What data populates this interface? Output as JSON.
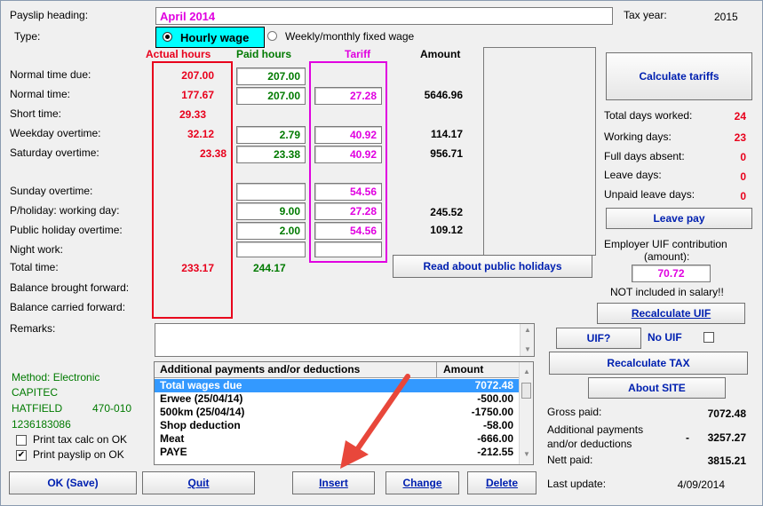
{
  "header": {
    "payslip_heading_label": "Payslip heading:",
    "payslip_heading_value": "April 2014",
    "tax_year_label": "Tax year:",
    "tax_year_value": "2015",
    "type_label": "Type:",
    "type_option_hourly": "Hourly wage",
    "type_option_weekly": "Weekly/monthly fixed wage"
  },
  "columns": {
    "actual_hours": "Actual hours",
    "paid_hours": "Paid hours",
    "tariff": "Tariff",
    "amount": "Amount"
  },
  "rows": [
    {
      "label": "Normal time due:",
      "actual": "207.00",
      "paid": "207.00",
      "tariff": "",
      "amount": ""
    },
    {
      "label": "Normal time:",
      "actual": "177.67",
      "paid": "207.00",
      "tariff": "27.28",
      "amount": "5646.96"
    },
    {
      "label": "Short time:",
      "actual": "29.33",
      "paid": "",
      "tariff": "",
      "amount": ""
    },
    {
      "label": "Weekday overtime:",
      "actual": "32.12",
      "paid": "2.79",
      "tariff": "40.92",
      "amount": "114.17"
    },
    {
      "label": "Saturday overtime:",
      "actual": "23.38",
      "paid": "23.38",
      "tariff": "40.92",
      "amount": "956.71"
    },
    {
      "label": "Sunday overtime:",
      "actual": "",
      "paid": "",
      "tariff": "54.56",
      "amount": ""
    },
    {
      "label": "P/holiday: working day:",
      "actual": "",
      "paid": "9.00",
      "tariff": "27.28",
      "amount": "245.52"
    },
    {
      "label": "Public holiday overtime:",
      "actual": "",
      "paid": "2.00",
      "tariff": "54.56",
      "amount": "109.12"
    },
    {
      "label": "Night work:",
      "actual": "",
      "paid": "",
      "tariff": "",
      "amount": ""
    },
    {
      "label": "Total time:",
      "actual": "233.17",
      "paid": "244.17",
      "tariff": "",
      "amount": ""
    },
    {
      "label": "Balance brought forward:"
    },
    {
      "label": "Balance carried forward:"
    }
  ],
  "remarks_label": "Remarks:",
  "bank": {
    "method": "Method: Electronic",
    "bank_name": "CAPITEC",
    "branch": "HATFIELD",
    "branch_code": "470-010",
    "account": "1236183086",
    "print_tax_calc": "Print tax calc on OK",
    "print_payslip": "Print payslip on OK"
  },
  "right_panel": {
    "calculate_tariffs": "Calculate tariffs",
    "total_days_worked_label": "Total days worked:",
    "total_days_worked": "24",
    "working_days_label": "Working days:",
    "working_days": "23",
    "full_days_absent_label": "Full days absent:",
    "full_days_absent": "0",
    "leave_days_label": "Leave days:",
    "leave_days": "0",
    "unpaid_leave_label": "Unpaid leave days:",
    "unpaid_leave": "0",
    "leave_pay": "Leave pay",
    "uif_label_1": "Employer UIF contribution",
    "uif_label_2": "(amount):",
    "uif_value": "70.72",
    "not_included": "NOT included in salary!!",
    "recalculate_uif": "Recalculate UIF",
    "uif_q": "UIF?",
    "no_uif": "No UIF",
    "recalculate_tax": "Recalculate TAX",
    "about_site": "About SITE",
    "gross_paid_label": "Gross paid:",
    "gross_paid": "7072.48",
    "additional_label_1": "Additional payments",
    "additional_label_2": "and/or deductions",
    "additional_sign": "-",
    "additional_value": "3257.27",
    "nett_paid_label": "Nett paid:",
    "nett_paid": "3815.21",
    "last_update_label": "Last update:",
    "last_update": "4/09/2014"
  },
  "read_holidays": "Read about public holidays",
  "payments": {
    "header_desc": "Additional payments and/or deductions",
    "header_amount": "Amount",
    "items": [
      {
        "desc": "Total wages due",
        "amount": "7072.48"
      },
      {
        "desc": "Erwee (25/04/14)",
        "amount": "-500.00"
      },
      {
        "desc": "500km (25/04/14)",
        "amount": "-1750.00"
      },
      {
        "desc": "Shop deduction",
        "amount": "-58.00"
      },
      {
        "desc": "Meat",
        "amount": "-666.00"
      },
      {
        "desc": "PAYE",
        "amount": "-212.55"
      }
    ]
  },
  "buttons": {
    "ok": "OK (Save)",
    "quit": "Quit",
    "insert": "Insert",
    "change": "Change",
    "delete": "Delete"
  },
  "colors": {
    "actual": "#e8001c",
    "paid": "#007a00",
    "tariff": "#e000e0",
    "button_text": "#0020b0",
    "selection": "#3399ff",
    "annotation_arrow": "#e8473b"
  }
}
